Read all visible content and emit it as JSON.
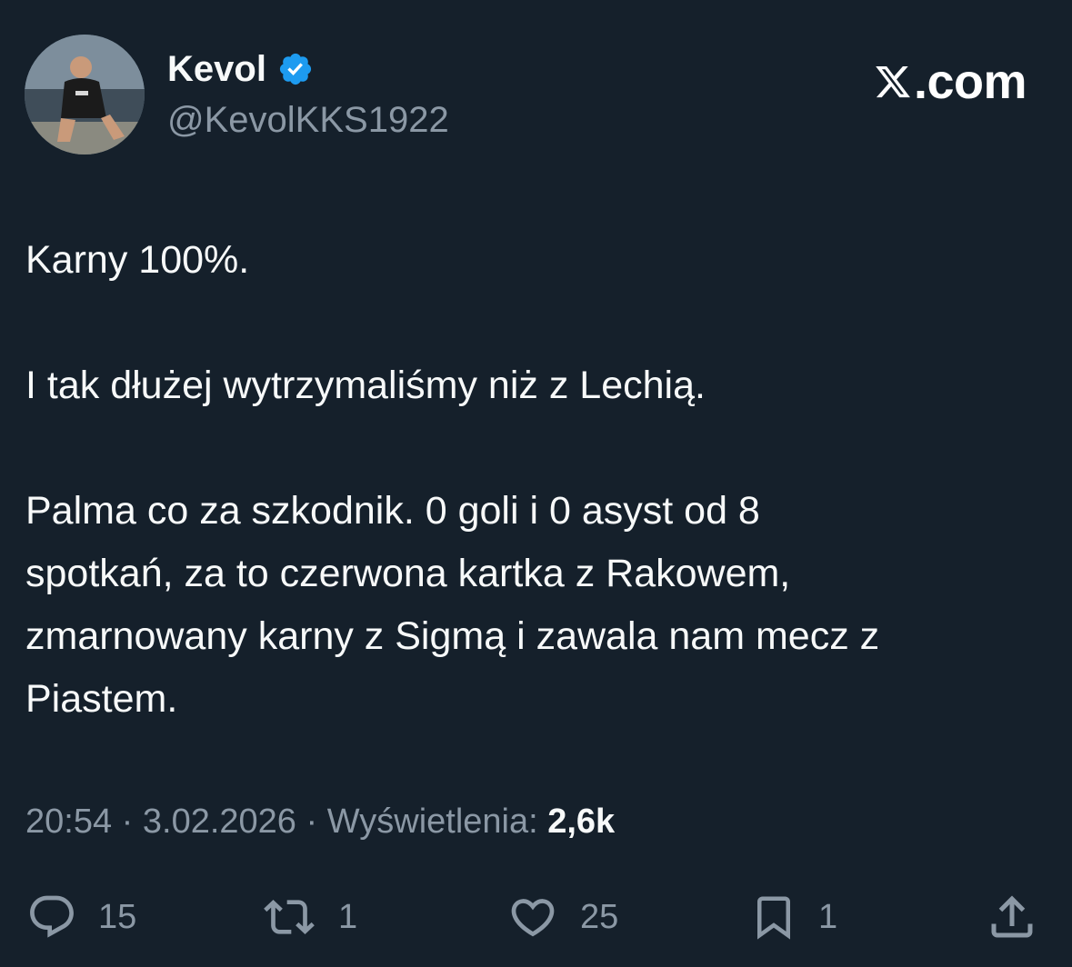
{
  "author": {
    "display_name": "Kevol",
    "handle": "@KevolKKS1922",
    "verified": true,
    "verified_color": "#1d9bf0"
  },
  "brand": {
    "text": ".com",
    "logo": "x-logo"
  },
  "tweet": {
    "paragraphs": [
      "Karny 100%.",
      "I tak dłużej wytrzymaliśmy niż z Lechią.",
      "Palma co za szkodnik. 0 goli i 0 asyst od 8\nspotkań, za to czerwona kartka z Rakowem,\nzmarnowany karny z Sigmą i zawala nam mecz z\nPiastem."
    ]
  },
  "meta": {
    "time": "20:54",
    "separator": " · ",
    "date": "3.02.2026",
    "views_label": "Wyświetlenia:",
    "views_count": "2,6k"
  },
  "actions": {
    "reply": {
      "icon": "reply-icon",
      "count": "15"
    },
    "retweet": {
      "icon": "retweet-icon",
      "count": "1"
    },
    "like": {
      "icon": "heart-icon",
      "count": "25"
    },
    "bookmark": {
      "icon": "bookmark-icon",
      "count": "1"
    },
    "share": {
      "icon": "share-icon"
    }
  },
  "colors": {
    "background": "#15202b",
    "text_primary": "#f7f9f9",
    "text_secondary": "#8b98a5"
  }
}
